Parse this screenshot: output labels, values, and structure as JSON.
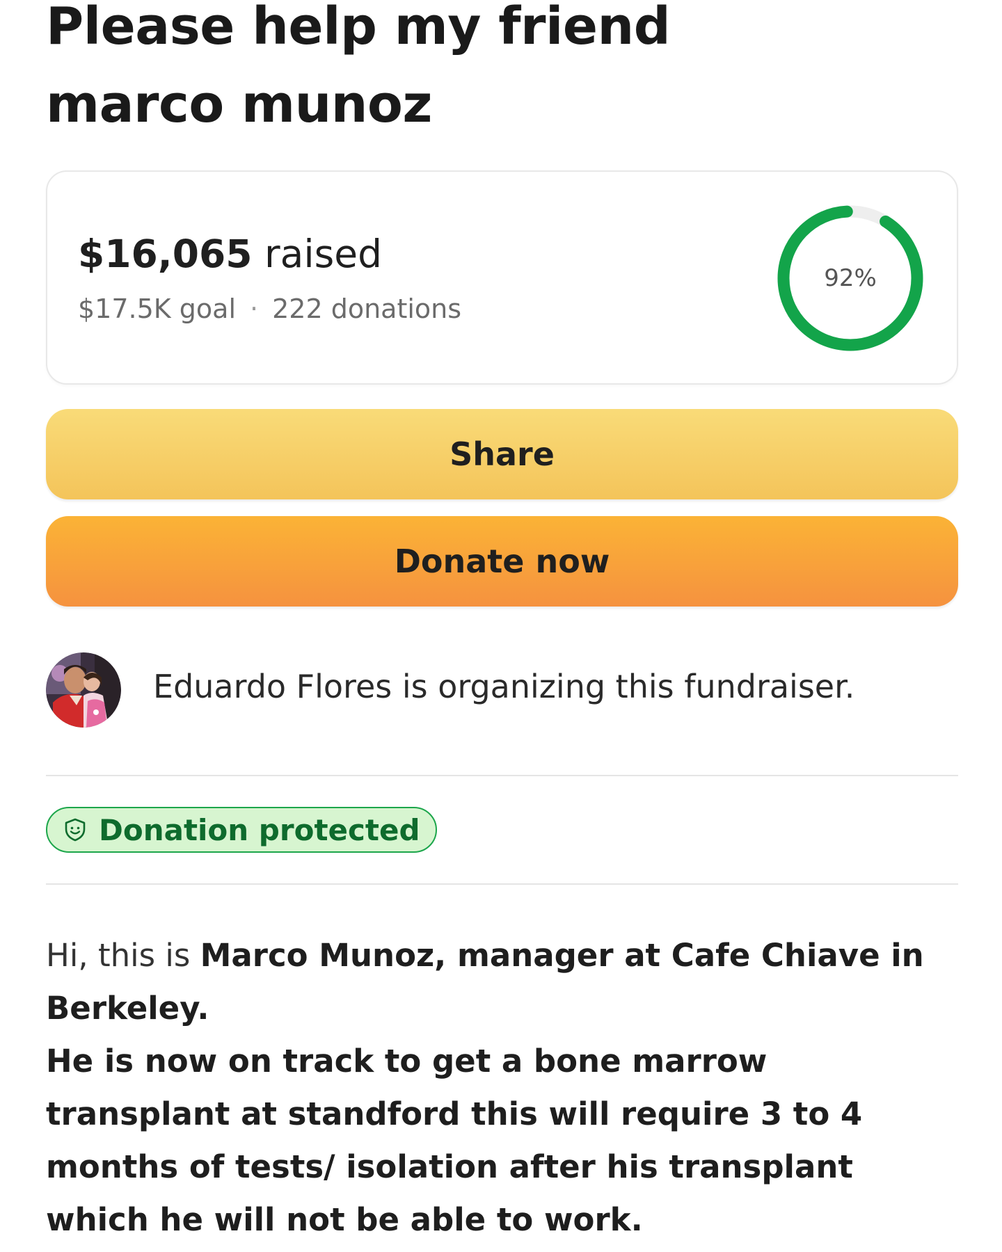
{
  "title": "Please help my friend marco munoz",
  "progress": {
    "raised_amount": "$16,065",
    "raised_suffix": " raised",
    "goal": "$17.5K goal",
    "separator": "·",
    "donations": "222 donations",
    "percent_label": "92%",
    "percent_value": 0.92,
    "ring_color": "#13a44a",
    "track_color": "#eeeeee"
  },
  "buttons": {
    "share_label": "Share",
    "donate_label": "Donate now"
  },
  "organizer": {
    "text": "Eduardo Flores is organizing this fundraiser."
  },
  "badge": {
    "label": "Donation protected",
    "icon": "shield-smile-icon",
    "color": "#1ca64b"
  },
  "story": {
    "intro": "Hi, this is ",
    "intro_bold": "Marco Munoz, manager at Cafe Chiave in Berkeley.",
    "body_bold": "He is now on track to get a bone marrow transplant at standford this will require 3 to 4 months of tests/ isolation after his transplant which he will not be able to work."
  }
}
